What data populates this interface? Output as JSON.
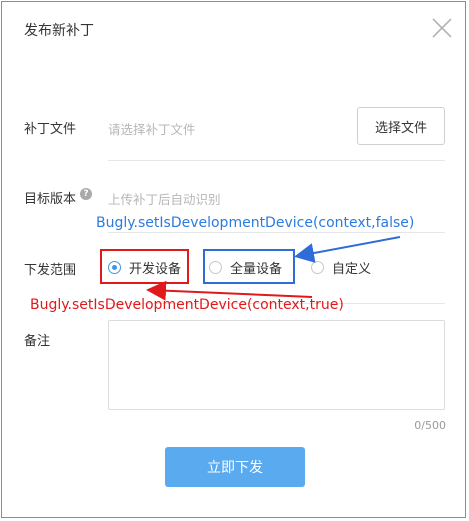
{
  "dialog": {
    "title": "发布新补丁"
  },
  "form": {
    "patch_file": {
      "label": "补丁文件",
      "placeholder": "请选择补丁文件",
      "button_label": "选择文件"
    },
    "target_version": {
      "label": "目标版本",
      "help_icon_glyph": "?",
      "placeholder": "上传补丁后自动识别"
    },
    "scope": {
      "label": "下发范围",
      "options": [
        {
          "label": "开发设备",
          "checked": true
        },
        {
          "label": "全量设备",
          "checked": false
        },
        {
          "label": "自定义",
          "checked": false
        }
      ]
    },
    "remark": {
      "label": "备注",
      "value": "",
      "char_count": "0/500"
    },
    "submit_label": "立即下发"
  },
  "annotations": {
    "blue_text": "Bugly.setIsDevelopmentDevice(context,false)",
    "red_text": "Bugly.setIsDevelopmentDevice(context,true)",
    "blue_color": "#2b7be0",
    "red_color": "#e0191b"
  },
  "icons": {
    "close": "close-icon",
    "help": "help-icon"
  },
  "colors": {
    "primary": "#5aaaf0",
    "radio_checked": "#3d97e8"
  }
}
